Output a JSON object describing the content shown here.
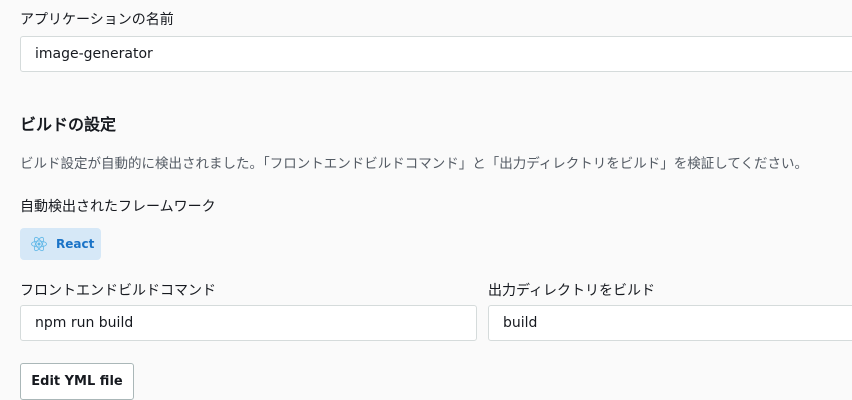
{
  "app_name": {
    "label": "アプリケーションの名前",
    "value": "image-generator"
  },
  "build_settings": {
    "title": "ビルドの設定",
    "description": "ビルド設定が自動的に検出されました。「フロントエンドビルドコマンド」と「出力ディレクトリをビルド」を検証してください。",
    "framework_label": "自動検出されたフレームワーク",
    "framework": {
      "name": "React",
      "icon": "react-icon",
      "color": "#1a73c7"
    },
    "frontend_build_command": {
      "label": "フロントエンドビルドコマンド",
      "value": "npm run build"
    },
    "output_directory": {
      "label": "出力ディレクトリをビルド",
      "value": "build"
    },
    "edit_yml_button": "Edit YML file"
  }
}
